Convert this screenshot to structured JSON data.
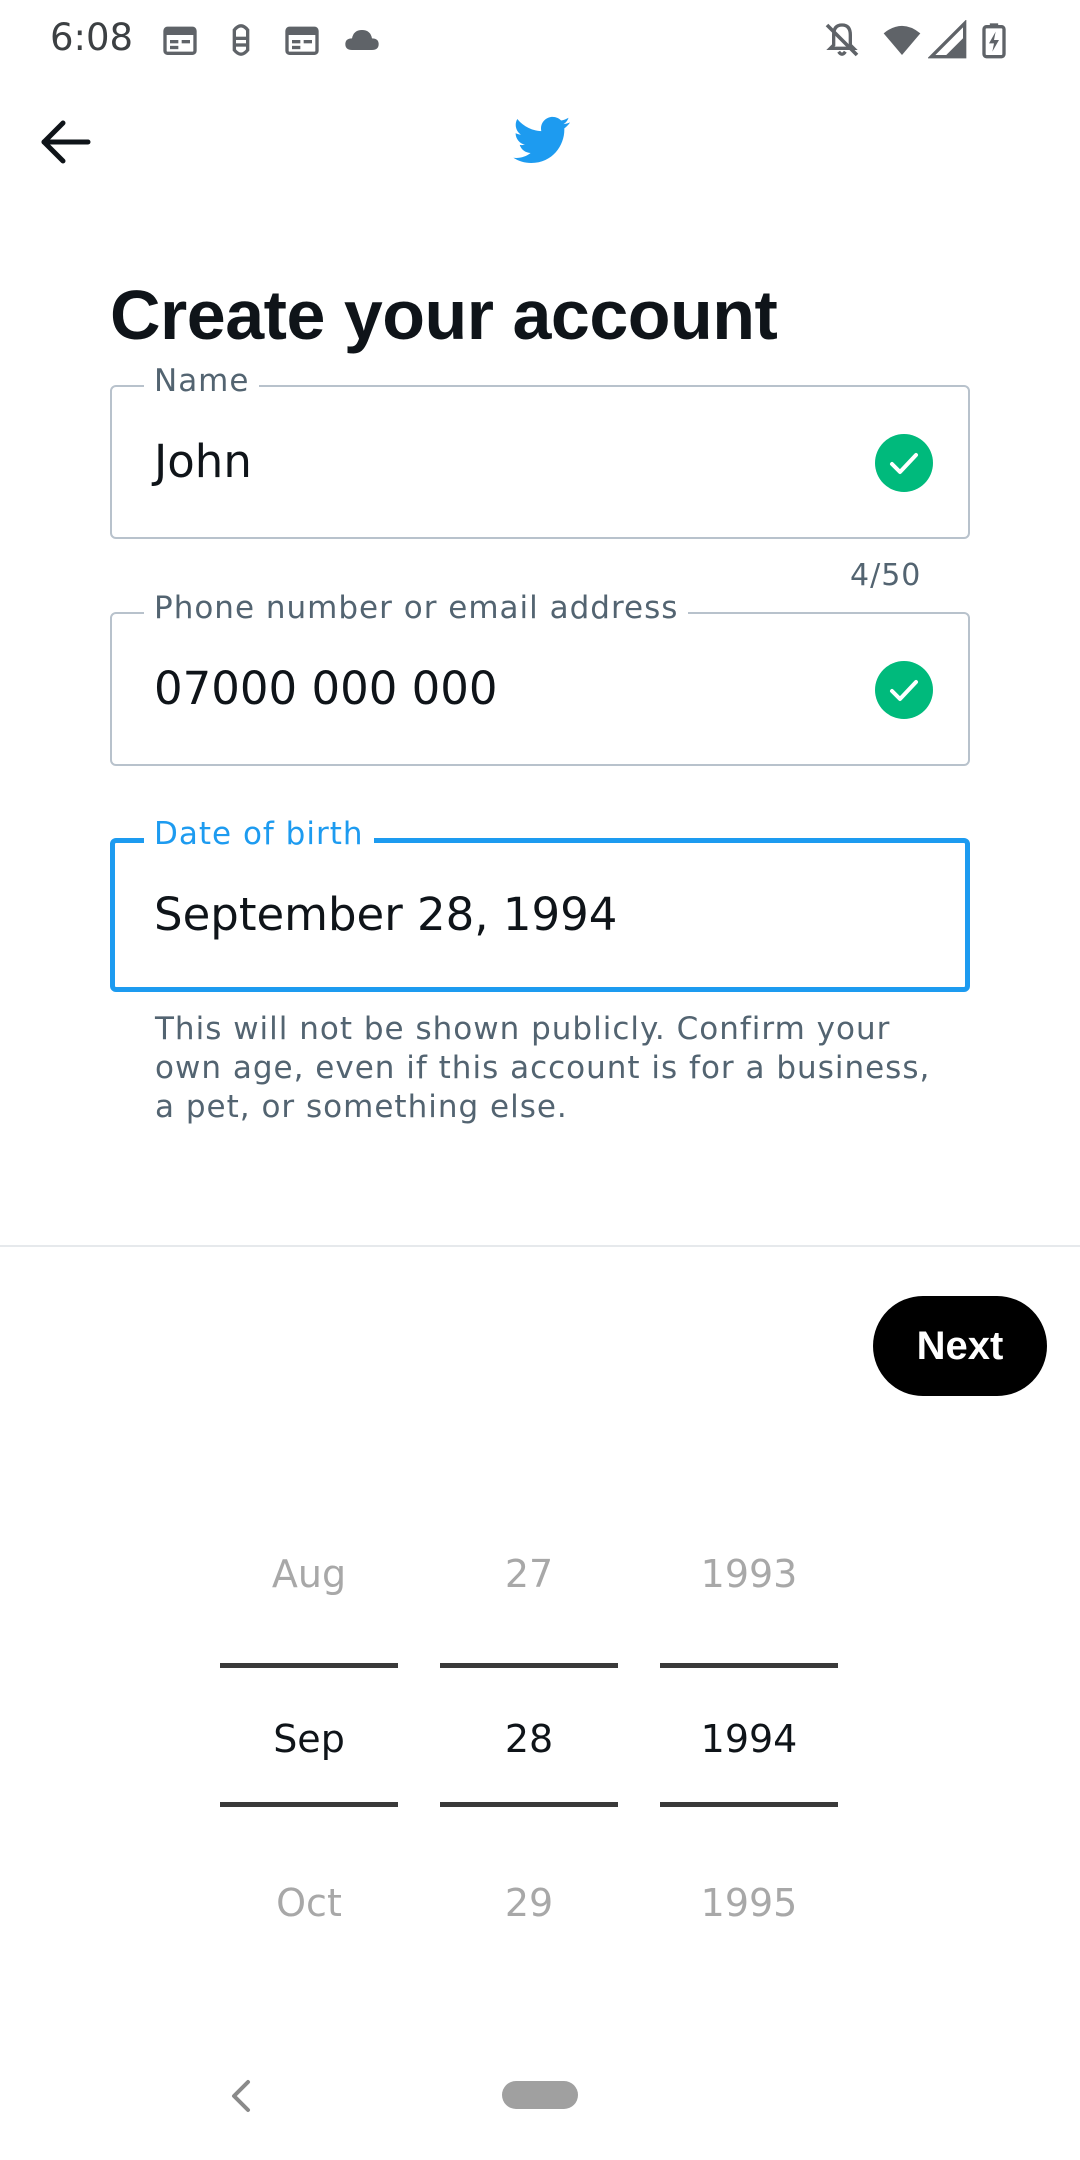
{
  "status_bar": {
    "time": "6:08",
    "left_icons": [
      "calendar-icon",
      "bug-icon",
      "calendar-icon",
      "cloud-icon"
    ],
    "right_icons": [
      "notifications-off-icon",
      "wifi-icon",
      "cell-signal-icon",
      "battery-charging-icon"
    ]
  },
  "header": {
    "back_icon": "arrow-left-icon",
    "logo_icon": "twitter-bird-icon",
    "brand_color": "#1d9bf0"
  },
  "page": {
    "title": "Create your account"
  },
  "form": {
    "name": {
      "label": "Name",
      "value": "John",
      "counter": "4/50",
      "valid": true
    },
    "contact": {
      "label": "Phone number or email address",
      "value": "07000 000 000",
      "valid": true
    },
    "dob": {
      "label": "Date of birth",
      "value": "September 28, 1994",
      "focused": true
    },
    "helper": "This will not be shown publicly. Confirm your own age, even if this account is for a business, a pet, or something else."
  },
  "actions": {
    "next_label": "Next"
  },
  "date_picker": {
    "month": {
      "prev": "Aug",
      "selected": "Sep",
      "next": "Oct"
    },
    "day": {
      "prev": "27",
      "selected": "28",
      "next": "29"
    },
    "year": {
      "prev": "1993",
      "selected": "1994",
      "next": "1995"
    }
  },
  "colors": {
    "accent": "#1d9bf0",
    "valid": "#00ba7c",
    "button_bg": "#000000",
    "text_secondary": "#536471"
  },
  "nav_bar": {
    "back_icon": "nav-back-icon",
    "home_icon": "home-pill-icon"
  }
}
